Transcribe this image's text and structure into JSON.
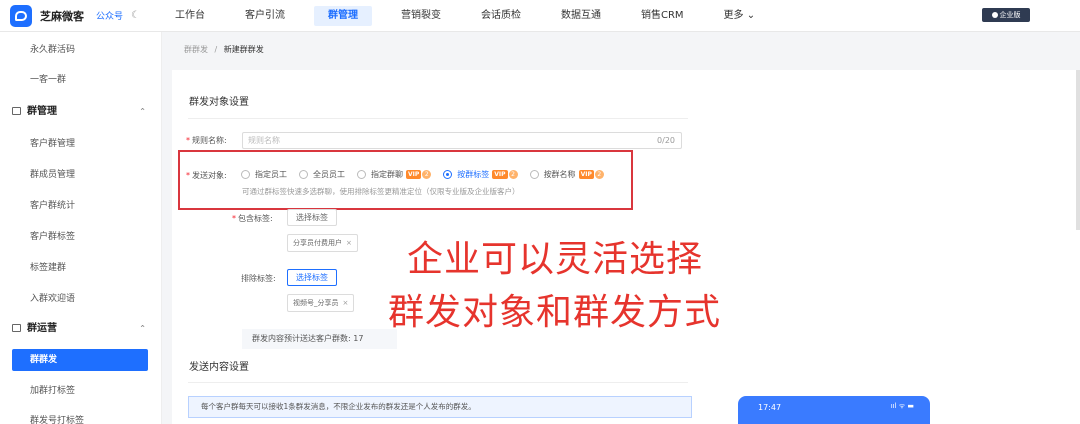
{
  "app": {
    "brand": "芝麻微客",
    "account_type": "公众号",
    "enterprise_label": "企业版"
  },
  "nav": {
    "items": [
      "工作台",
      "客户引流",
      "群管理",
      "营销裂变",
      "会话质检",
      "数据互通",
      "销售CRM",
      "更多 ⌄"
    ],
    "active_index": 2
  },
  "sidebar": {
    "items": [
      {
        "label": "永久群活码",
        "type": "item"
      },
      {
        "label": "一客一群",
        "type": "item"
      },
      {
        "label": "群管理",
        "type": "group"
      },
      {
        "label": "客户群管理",
        "type": "item"
      },
      {
        "label": "群成员管理",
        "type": "item"
      },
      {
        "label": "客户群统计",
        "type": "item"
      },
      {
        "label": "客户群标签",
        "type": "item"
      },
      {
        "label": "标签建群",
        "type": "item"
      },
      {
        "label": "入群欢迎语",
        "type": "item"
      },
      {
        "label": "群运营",
        "type": "group"
      },
      {
        "label": "群群发",
        "type": "active"
      },
      {
        "label": "加群打标签",
        "type": "item"
      },
      {
        "label": "群发号打标签",
        "type": "item"
      }
    ]
  },
  "breadcrumb": {
    "parent": "群群发",
    "separator": "/",
    "current": "新建群群发"
  },
  "form": {
    "section1_title": "群发对象设置",
    "rule_name_label": "规则名称:",
    "rule_name_placeholder": "规则名称",
    "rule_name_counter": "0/20",
    "target_label": "发送对象:",
    "target_options": [
      {
        "label": "指定员工",
        "vip": false,
        "checked": false
      },
      {
        "label": "全员员工",
        "vip": false,
        "checked": false
      },
      {
        "label": "指定群聊",
        "vip": true,
        "checked": false
      },
      {
        "label": "按群标签",
        "vip": true,
        "checked": true
      },
      {
        "label": "按群名称",
        "vip": true,
        "checked": false
      }
    ],
    "vip_text": "VIP",
    "vip_level": "2",
    "target_hint": "可通过群标签快速多选群聊，使用排除标签更精准定位（仅限专业版及企业版客户）",
    "include_label": "包含标签:",
    "include_button": "选择标签",
    "include_tag": "分享员付费用户",
    "exclude_label": "排除标签:",
    "exclude_button": "选择标签",
    "exclude_tag": "视频号_分享员",
    "tag_close": "×",
    "estimate_text": "群发内容预计送达客户群数: 17",
    "section2_title": "发送内容设置",
    "notice": "每个客户群每天可以接收1条群发消息，不限企业发布的群发还是个人发布的群发。"
  },
  "overlay": {
    "line1": "企业可以灵活选择",
    "line2": "群发对象和群发方式"
  },
  "phone": {
    "time": "17:47",
    "status": "ııl ᯤ ▬"
  }
}
